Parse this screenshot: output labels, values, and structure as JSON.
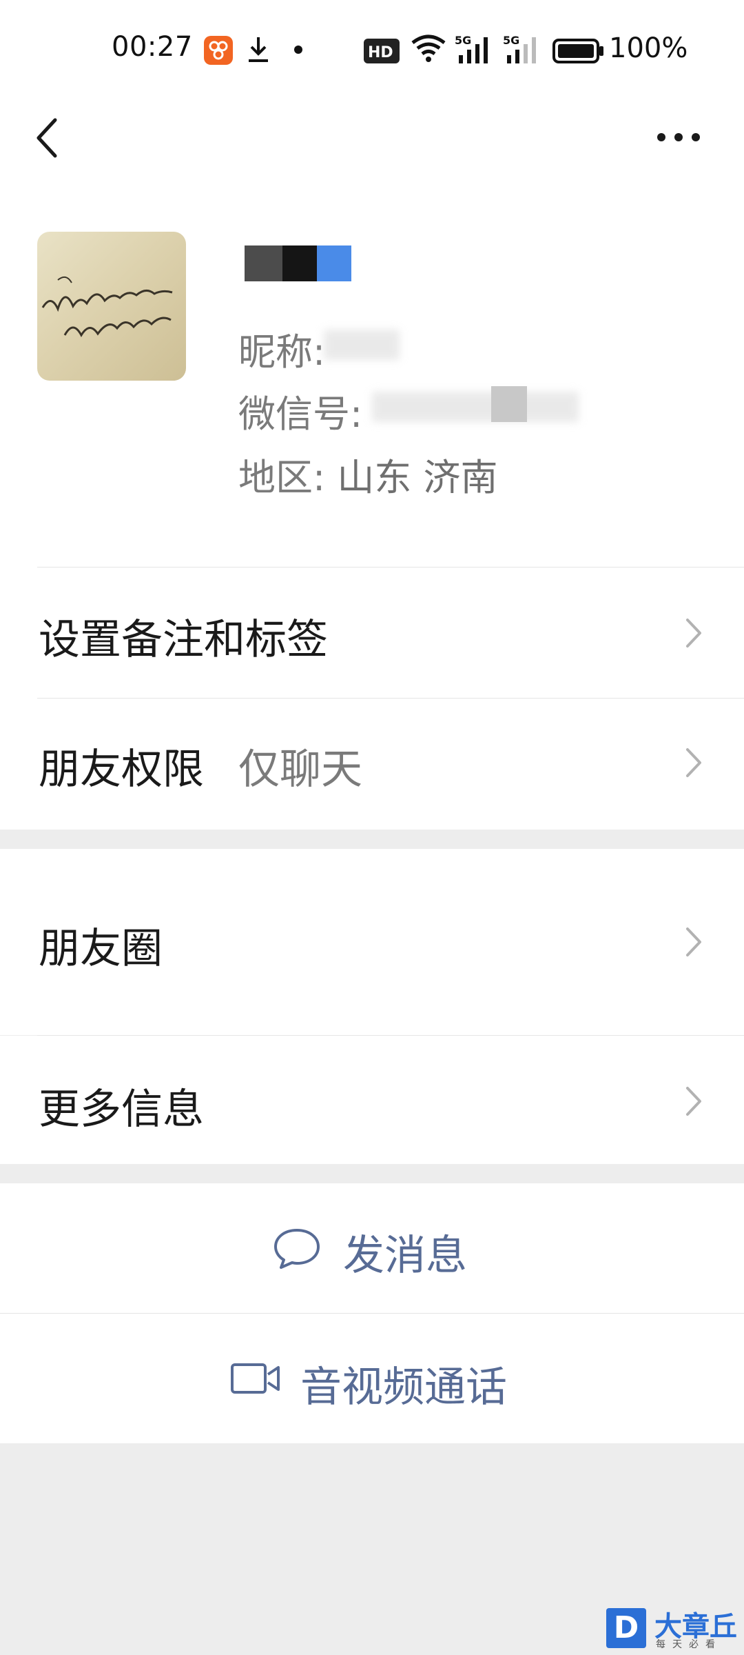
{
  "status_bar": {
    "time": "00:27",
    "battery_text": "100%",
    "network_1": "5G",
    "network_2": "5G",
    "hd_badge": "HD"
  },
  "nav": {
    "back_icon": "chevron-left-icon",
    "more_icon": "more-dots-icon"
  },
  "profile": {
    "nickname_label": "昵称:",
    "wechat_id_label": "微信号:",
    "region_label": "地区:",
    "region_value": "山东  济南"
  },
  "menu": {
    "remark_tags": "设置备注和标签",
    "friend_permission": "朋友权限",
    "friend_permission_value": "仅聊天",
    "moments": "朋友圈",
    "more_info": "更多信息"
  },
  "actions": {
    "send_message": "发消息",
    "av_call": "音视频通话"
  },
  "watermark": {
    "logo_letter": "D",
    "title": "大章丘",
    "subtitle": "每天必看"
  },
  "colors": {
    "link_blue": "#576b95",
    "background_gray": "#ededed",
    "watermark_blue": "#2b6fd6"
  }
}
